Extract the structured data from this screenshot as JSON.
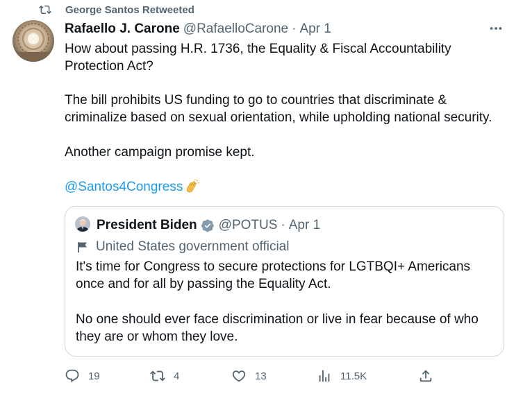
{
  "social_context": {
    "text": "George Santos Retweeted",
    "icon": "retweet-icon"
  },
  "tweet": {
    "author_name": "Rafaello J. Carone",
    "author_handle": "@RafaelloCarone",
    "separator": "·",
    "time": "Apr 1",
    "paragraphs": [
      "How about passing H.R. 1736, the Equality & Fiscal Accountability Protection Act?",
      "The bill prohibits US funding to go to countries that discriminate & criminalize based on sexual orientation, while upholding national security.",
      "Another campaign promise kept."
    ],
    "mention": "@Santos4Congress",
    "emoji_icon": "clapping-hands-icon"
  },
  "quote": {
    "author_name": "President Biden",
    "verified_icon": "verified-badge-icon",
    "author_handle": "@POTUS",
    "separator": "·",
    "time": "Apr 1",
    "affiliation": "United States government official",
    "paragraphs": [
      "It's time for Congress to secure protections for LGTBQI+ Americans once and for all by passing the Equality Act.",
      "No one should ever face discrimination or live in fear because of who they are or whom they love."
    ]
  },
  "actions": {
    "replies": "19",
    "retweets": "4",
    "likes": "13",
    "views": "11.5K"
  },
  "colors": {
    "text_primary": "#0f1419",
    "text_secondary": "#536471",
    "link": "#1d9bf0",
    "border": "#cfd9de",
    "verified_gold": "#e2b719"
  }
}
